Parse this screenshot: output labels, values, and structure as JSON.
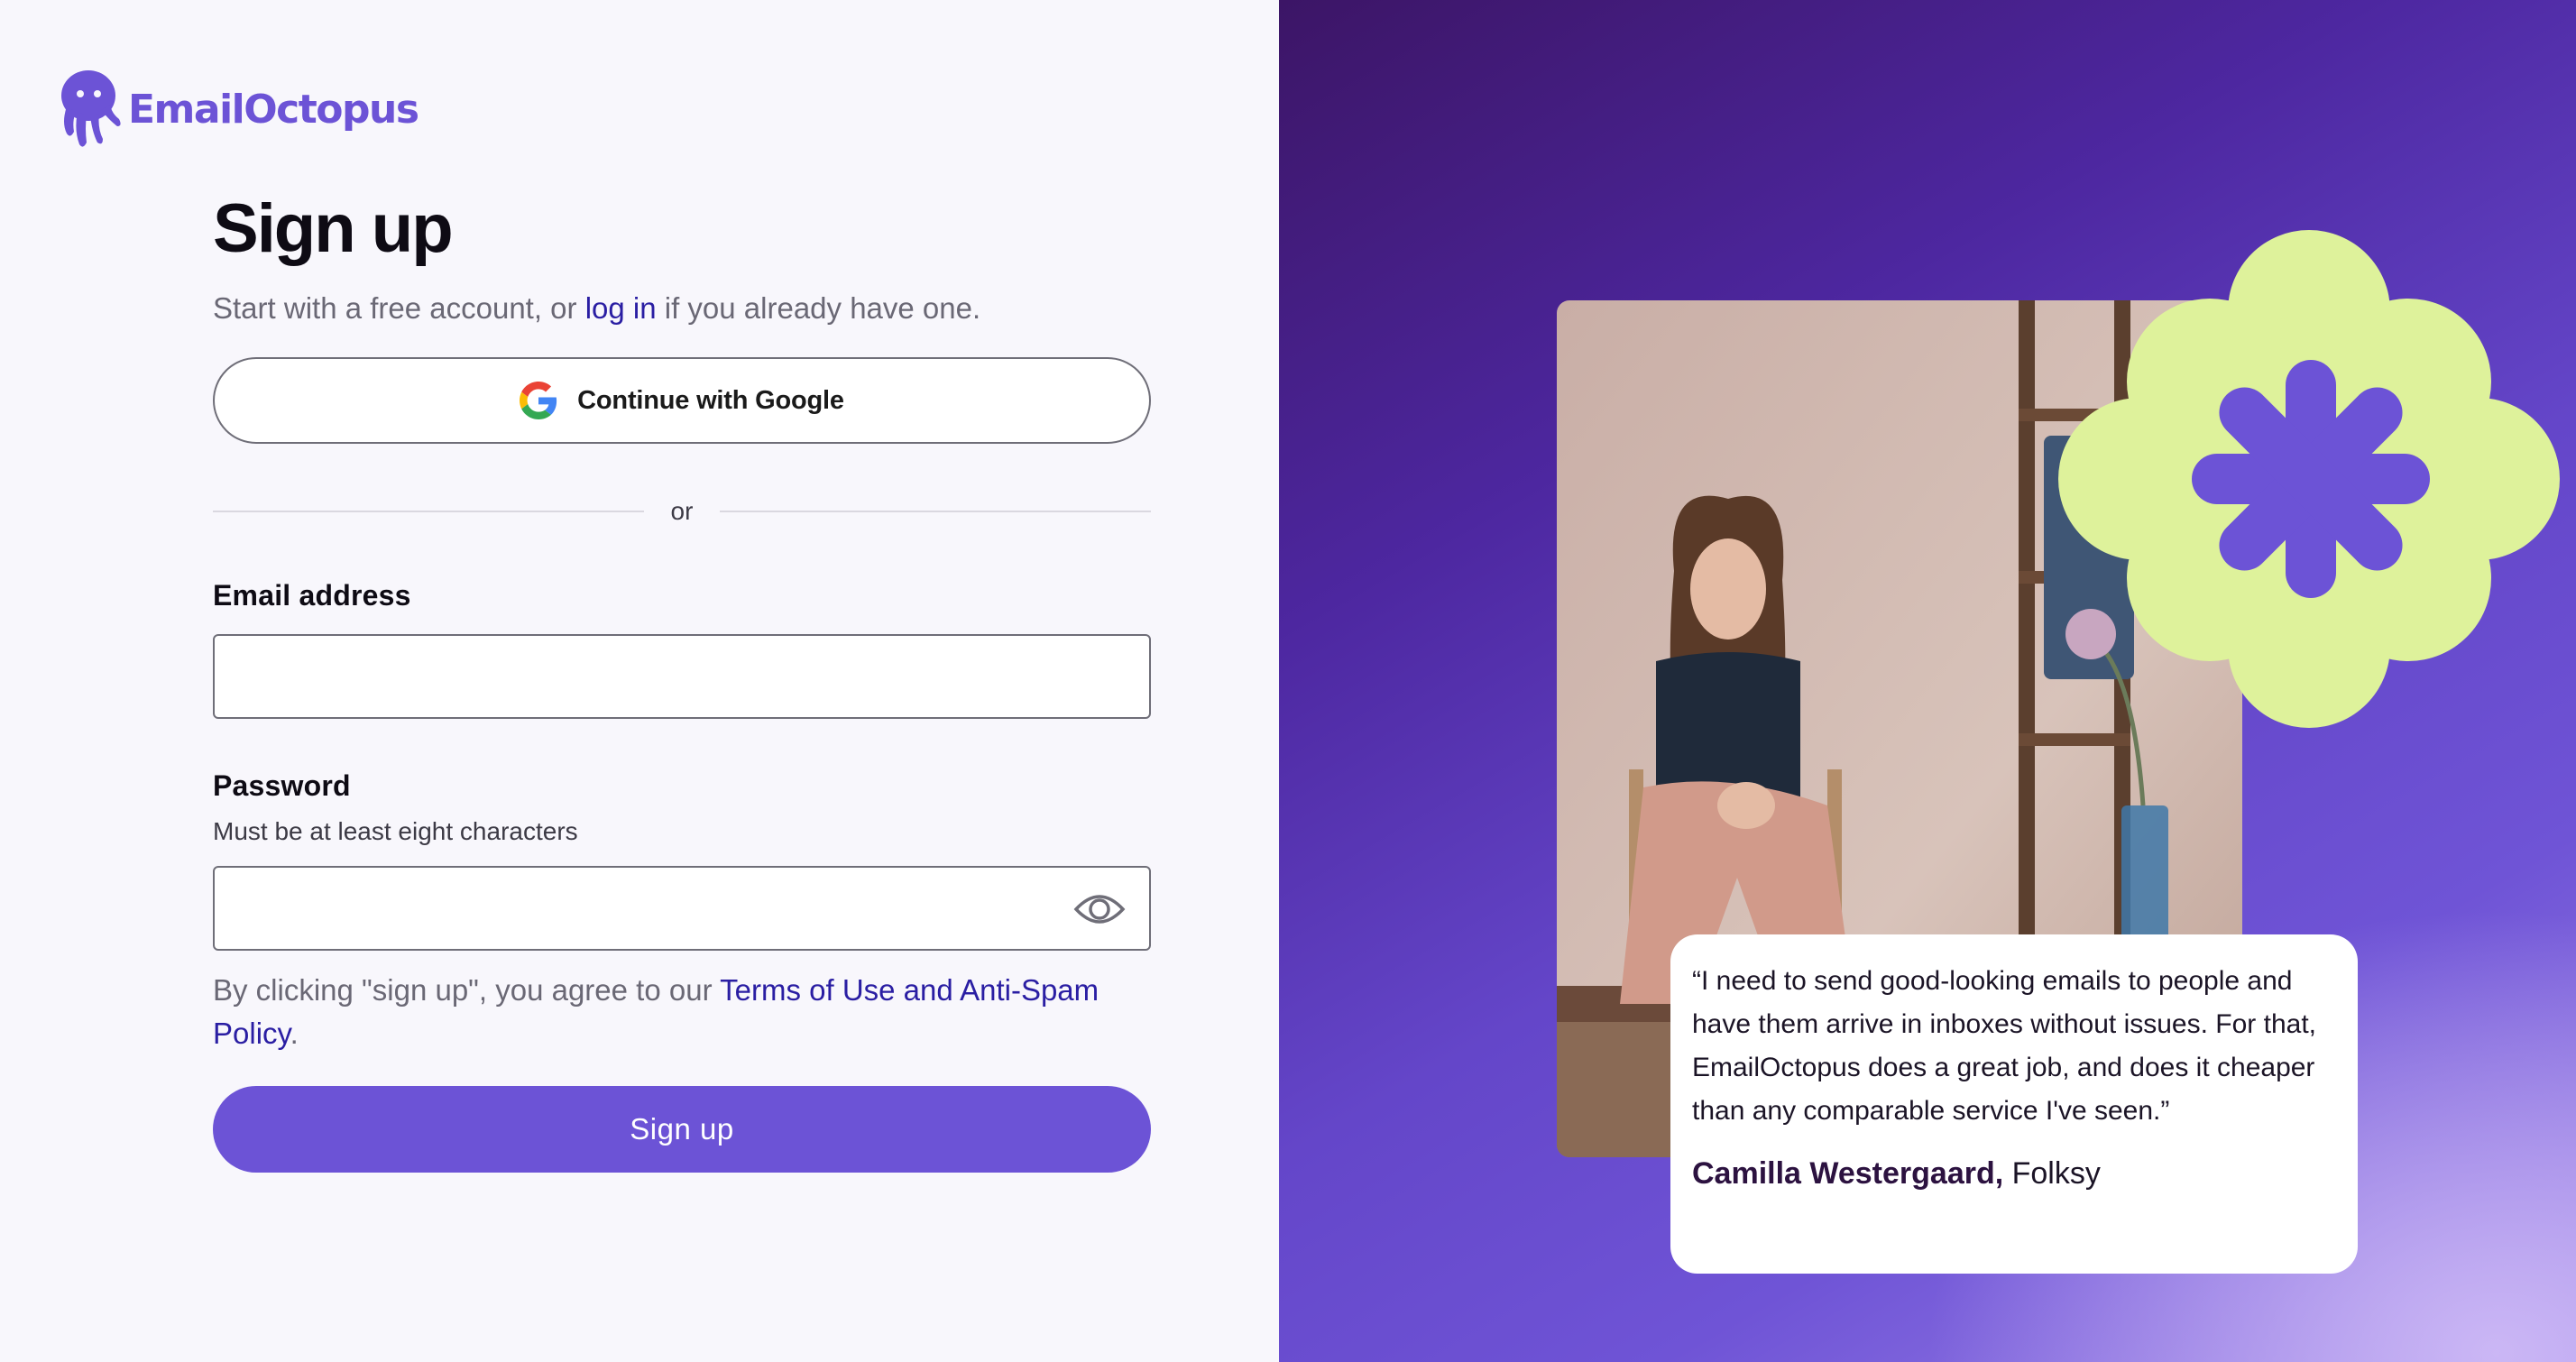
{
  "brand": {
    "name": "EmailOctopus",
    "accent": "#6c53d6",
    "link": "#2a1ea3"
  },
  "signup": {
    "title": "Sign up",
    "subtitle_pre": "Start with a free account, or ",
    "login_link": "log in",
    "subtitle_post": " if you already have one.",
    "google_button": "Continue with Google",
    "divider": "or",
    "email_label": "Email address",
    "email_value": "",
    "password_label": "Password",
    "password_hint": "Must be at least eight characters",
    "password_value": "",
    "terms_pre": "By clicking \"sign up\", you agree to our ",
    "terms_link": "Terms of Use and Anti-Spam Policy",
    "terms_post": ".",
    "submit": "Sign up"
  },
  "testimonial": {
    "quote": "“I need to send good-looking emails to people and have them arrive in inboxes without issues. For that, EmailOctopus does a great job, and does it cheaper than any comparable service I've seen.”",
    "author_name": "Camilla Westergaard,",
    "author_company": " Folksy"
  },
  "icons": {
    "logo": "octopus-logo-icon",
    "google": "google-g-icon",
    "password_toggle": "eye-icon",
    "decoration": "flower-asterisk-icon"
  }
}
